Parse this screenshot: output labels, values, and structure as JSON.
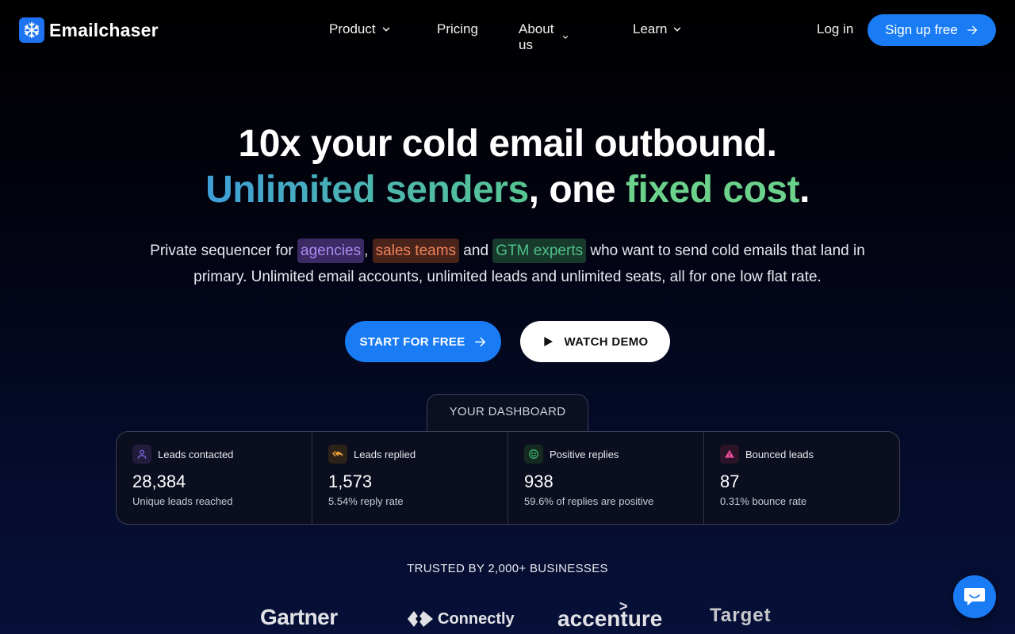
{
  "brand": {
    "name": "Emailchaser",
    "logo_icon": "snowflake-icon"
  },
  "nav": {
    "items": [
      {
        "label": "Product",
        "has_dropdown": true
      },
      {
        "label": "Pricing",
        "has_dropdown": false
      },
      {
        "label": "About us",
        "has_dropdown": true
      },
      {
        "label": "Learn",
        "has_dropdown": true
      }
    ],
    "login_label": "Log in",
    "signup_label": "Sign up free"
  },
  "hero": {
    "line1": "10x your cold email outbound.",
    "line2_gradient": "Unlimited senders",
    "line2_middle": ", one ",
    "line2_green": "fixed cost",
    "line2_end": ".",
    "sub_prefix": "Private sequencer for ",
    "tag_agencies": "agencies",
    "sub_comma": ", ",
    "tag_sales": "sales teams",
    "sub_and": " and ",
    "tag_gtm": "GTM experts",
    "sub_rest": " who want to send cold emails that land in primary. Unlimited email accounts, unlimited leads and unlimited seats, all for one low flat rate.",
    "start_label": "START FOR FREE",
    "demo_label": "WATCH DEMO"
  },
  "dashboard": {
    "tab_label": "YOUR DASHBOARD",
    "stats": [
      {
        "label": "Leads contacted",
        "value": "28,384",
        "sub": "Unique leads reached",
        "icon": "user-icon",
        "color": "#8b6cf0"
      },
      {
        "label": "Leads replied",
        "value": "1,573",
        "sub": "5.54% reply rate",
        "icon": "reply-all-icon",
        "color": "#f0a13a"
      },
      {
        "label": "Positive replies",
        "value": "938",
        "sub": "59.6% of replies are positive",
        "icon": "smile-icon",
        "color": "#3fc47a"
      },
      {
        "label": "Bounced leads",
        "value": "87",
        "sub": "0.31% bounce rate",
        "icon": "warning-icon",
        "color": "#f04fa0"
      }
    ]
  },
  "trusted": {
    "label": "TRUSTED BY 2,000+ BUSINESSES",
    "logos": [
      "Gartner",
      "Connectly",
      "accenture",
      "Target"
    ]
  },
  "colors": {
    "accent": "#1a7cf5",
    "background": "#000000",
    "green": "#6bd18b"
  }
}
